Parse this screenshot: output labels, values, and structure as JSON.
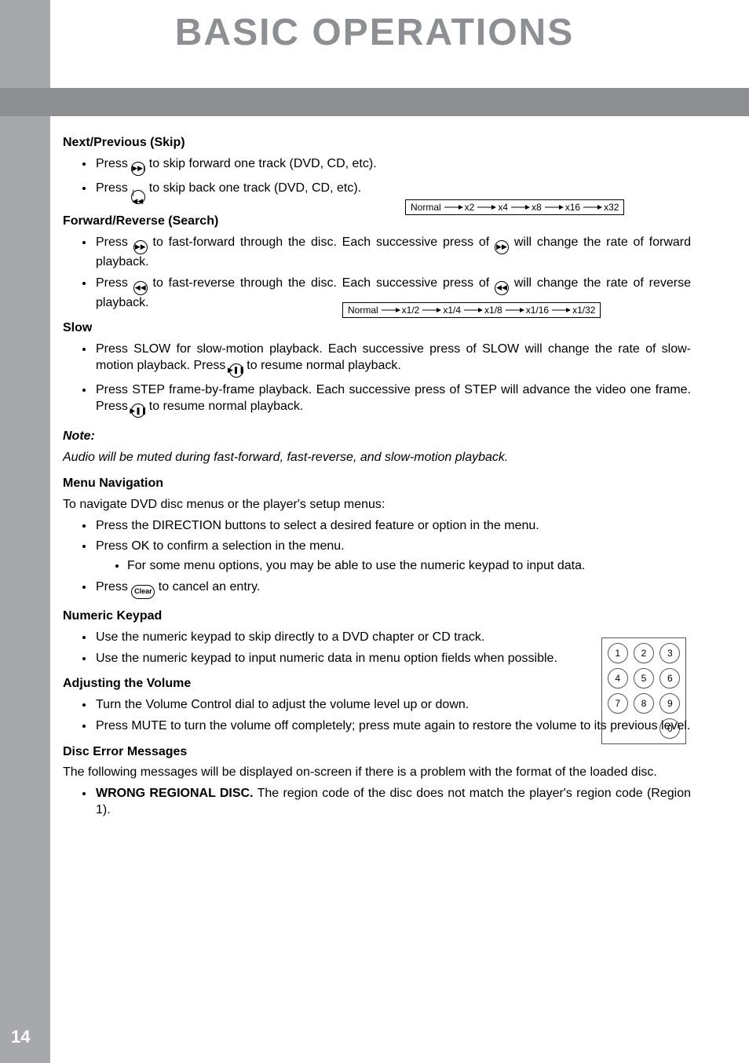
{
  "page_number": "14",
  "title": "BASIC OPERATIONS",
  "sections": {
    "skip": {
      "heading": "Next/Previous (Skip)",
      "items": [
        {
          "pre": "Press ",
          "icon": "skip-fwd-icon",
          "glyph": "▶▶|",
          "post": " to skip forward one track (DVD, CD, etc)."
        },
        {
          "pre": "Press ",
          "icon": "skip-back-icon",
          "glyph": "|◀◀",
          "post": " to skip back one track (DVD, CD, etc)."
        }
      ]
    },
    "search": {
      "heading": "Forward/Reverse (Search)",
      "rate_prefix": "Normal",
      "rates": [
        "x2",
        "x4",
        "x8",
        "x16",
        "x32"
      ],
      "items": [
        {
          "pre": "Press ",
          "icon1": "ff-icon",
          "glyph1": "▶▶",
          "mid": " to fast-forward through the disc. Each successive press of ",
          "icon2": "ff-icon",
          "glyph2": "▶▶",
          "post": " will change the rate of forward playback."
        },
        {
          "pre": "Press ",
          "icon1": "rew-icon",
          "glyph1": "◀◀",
          "mid": " to fast-reverse through the disc. Each successive press of ",
          "icon2": "rew-icon",
          "glyph2": "◀◀",
          "post": " will change the rate of reverse playback."
        }
      ]
    },
    "slow": {
      "heading": "Slow",
      "rate_prefix": "Normal",
      "rates": [
        "x1/2",
        "x1/4",
        "x1/8",
        "x1/16",
        "x1/32"
      ],
      "items": [
        {
          "pre": "Press SLOW for slow-motion playback. Each successive press of SLOW will change the rate of slow-motion playback. Press ",
          "icon": "play-pause-icon",
          "glyph": "▶❚❚",
          "post": " to resume normal playback."
        },
        {
          "pre": "Press STEP frame-by-frame playback. Each successive press of STEP will advance the video one frame. Press ",
          "icon": "play-pause-icon",
          "glyph": "▶❚❚",
          "post": " to resume normal playback."
        }
      ]
    },
    "note": {
      "heading": "Note:",
      "body": "Audio will be muted during fast-forward, fast-reverse, and slow-motion playback."
    },
    "menu": {
      "heading": "Menu Navigation",
      "intro": "To navigate DVD disc menus or the player's setup menus:",
      "items": [
        "Press the DIRECTION buttons to select a desired feature or option in the menu.",
        "Press OK to confirm a selection in the menu."
      ],
      "subitem": "For some menu options, you may be able to use the numeric keypad to input data.",
      "clear_item": {
        "pre": "Press ",
        "label": "Clear",
        "post": " to cancel an entry."
      }
    },
    "numeric": {
      "heading": "Numeric Keypad",
      "items": [
        "Use the numeric keypad to skip directly to a DVD chapter or CD track.",
        "Use the numeric keypad to input numeric data in menu option fields when possible."
      ],
      "keys": [
        "1",
        "2",
        "3",
        "4",
        "5",
        "6",
        "7",
        "8",
        "9",
        "0"
      ]
    },
    "volume": {
      "heading": "Adjusting the Volume",
      "items": [
        "Turn the Volume Control dial to adjust the volume level up or down.",
        "Press MUTE to turn the volume off completely; press mute again to restore the volume to its previous level."
      ]
    },
    "error": {
      "heading": "Disc Error Messages",
      "intro": "The following messages will be displayed on-screen if there is a problem with the format of the loaded disc.",
      "item_bold": "WRONG REGIONAL DISC.",
      "item_rest": " The region code of the disc does not match the player's region code (Region 1)."
    }
  }
}
